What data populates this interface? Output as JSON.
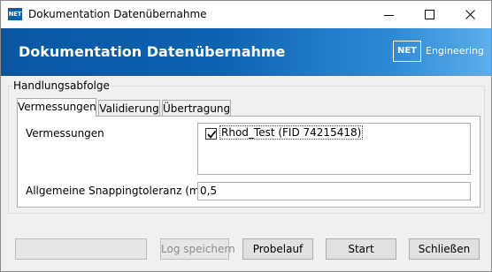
{
  "window": {
    "title": "Dokumentation Datenübernahme",
    "app_icon_text": "NET"
  },
  "banner": {
    "title": "Dokumentation Datenübernahme",
    "logo_box": "NET",
    "logo_text": "Engineering",
    "gradient_colors": [
      "#0a56a2",
      "#5eaeea"
    ]
  },
  "group": {
    "label": "Handlungsabfolge"
  },
  "tabs": [
    {
      "label": "Vermessungen",
      "active": true
    },
    {
      "label": "Validierung",
      "active": false
    },
    {
      "label": "Übertragung",
      "active": false
    }
  ],
  "panel": {
    "vermessungen_label": "Vermessungen",
    "items": [
      {
        "label": "Rhod_Test (FID 74215418)",
        "checked": true
      }
    ],
    "snapping_label": "Allgemeine Snappingtoleranz (m)",
    "snapping_value": "0,5"
  },
  "footer": {
    "progress": 0,
    "log_button": "Log speichern",
    "log_button_enabled": false,
    "probelauf_button": "Probelauf",
    "start_button": "Start",
    "close_button": "Schließen"
  },
  "icons": {
    "minimize": "minimize-icon",
    "maximize": "maximize-icon",
    "close": "close-icon",
    "check": "checkmark-icon"
  }
}
